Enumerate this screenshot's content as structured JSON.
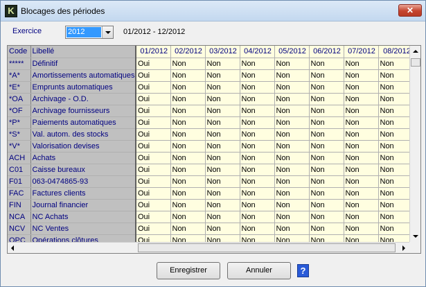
{
  "window": {
    "title": "Blocages des périodes",
    "close": "✕",
    "app_icon": "K"
  },
  "exercice": {
    "label": "Exercice",
    "value": "2012",
    "range": "01/2012 - 12/2012"
  },
  "grid": {
    "headers": [
      "Code",
      "Libellé",
      "01/2012",
      "02/2012",
      "03/2012",
      "04/2012",
      "05/2012",
      "06/2012",
      "07/2012",
      "08/2012"
    ],
    "rows": [
      {
        "code": "*****",
        "label": "Définitif",
        "values": [
          "Oui",
          "Non",
          "Non",
          "Non",
          "Non",
          "Non",
          "Non",
          "Non"
        ]
      },
      {
        "code": "*A*",
        "label": "Amortissements automatiques",
        "values": [
          "Oui",
          "Non",
          "Non",
          "Non",
          "Non",
          "Non",
          "Non",
          "Non"
        ]
      },
      {
        "code": "*E*",
        "label": "Emprunts automatiques",
        "values": [
          "Oui",
          "Non",
          "Non",
          "Non",
          "Non",
          "Non",
          "Non",
          "Non"
        ]
      },
      {
        "code": "*OA",
        "label": "Archivage - O.D.",
        "values": [
          "Oui",
          "Non",
          "Non",
          "Non",
          "Non",
          "Non",
          "Non",
          "Non"
        ]
      },
      {
        "code": "*OF",
        "label": "Archivage fournisseurs",
        "values": [
          "Oui",
          "Non",
          "Non",
          "Non",
          "Non",
          "Non",
          "Non",
          "Non"
        ]
      },
      {
        "code": "*P*",
        "label": "Paiements automatiques",
        "values": [
          "Oui",
          "Non",
          "Non",
          "Non",
          "Non",
          "Non",
          "Non",
          "Non"
        ]
      },
      {
        "code": "*S*",
        "label": "Val. autom. des stocks",
        "values": [
          "Oui",
          "Non",
          "Non",
          "Non",
          "Non",
          "Non",
          "Non",
          "Non"
        ]
      },
      {
        "code": "*V*",
        "label": "Valorisation devises",
        "values": [
          "Oui",
          "Non",
          "Non",
          "Non",
          "Non",
          "Non",
          "Non",
          "Non"
        ]
      },
      {
        "code": "ACH",
        "label": "Achats",
        "values": [
          "Oui",
          "Non",
          "Non",
          "Non",
          "Non",
          "Non",
          "Non",
          "Non"
        ]
      },
      {
        "code": "C01",
        "label": "Caisse bureaux",
        "values": [
          "Oui",
          "Non",
          "Non",
          "Non",
          "Non",
          "Non",
          "Non",
          "Non"
        ]
      },
      {
        "code": "F01",
        "label": "063-0474865-93",
        "values": [
          "Oui",
          "Non",
          "Non",
          "Non",
          "Non",
          "Non",
          "Non",
          "Non"
        ]
      },
      {
        "code": "FAC",
        "label": "Factures clients",
        "values": [
          "Oui",
          "Non",
          "Non",
          "Non",
          "Non",
          "Non",
          "Non",
          "Non"
        ]
      },
      {
        "code": "FIN",
        "label": "Journal financier",
        "values": [
          "Oui",
          "Non",
          "Non",
          "Non",
          "Non",
          "Non",
          "Non",
          "Non"
        ]
      },
      {
        "code": "NCA",
        "label": "NC Achats",
        "values": [
          "Oui",
          "Non",
          "Non",
          "Non",
          "Non",
          "Non",
          "Non",
          "Non"
        ]
      },
      {
        "code": "NCV",
        "label": "NC Ventes",
        "values": [
          "Oui",
          "Non",
          "Non",
          "Non",
          "Non",
          "Non",
          "Non",
          "Non"
        ]
      },
      {
        "code": "OPC",
        "label": "Opérations clôtures",
        "values": [
          "Oui",
          "Non",
          "Non",
          "Non",
          "Non",
          "Non",
          "Non",
          "Non"
        ]
      }
    ]
  },
  "buttons": {
    "save": "Enregistrer",
    "cancel": "Annuler",
    "help": "?"
  },
  "icons": {
    "dropdown": "chevron-down-icon",
    "help": "help-icon"
  },
  "colors": {
    "label_text": "#000080",
    "grid_bg": "#fffee0",
    "key_col_bg": "#c0c0c0",
    "selection": "#3399ff"
  }
}
